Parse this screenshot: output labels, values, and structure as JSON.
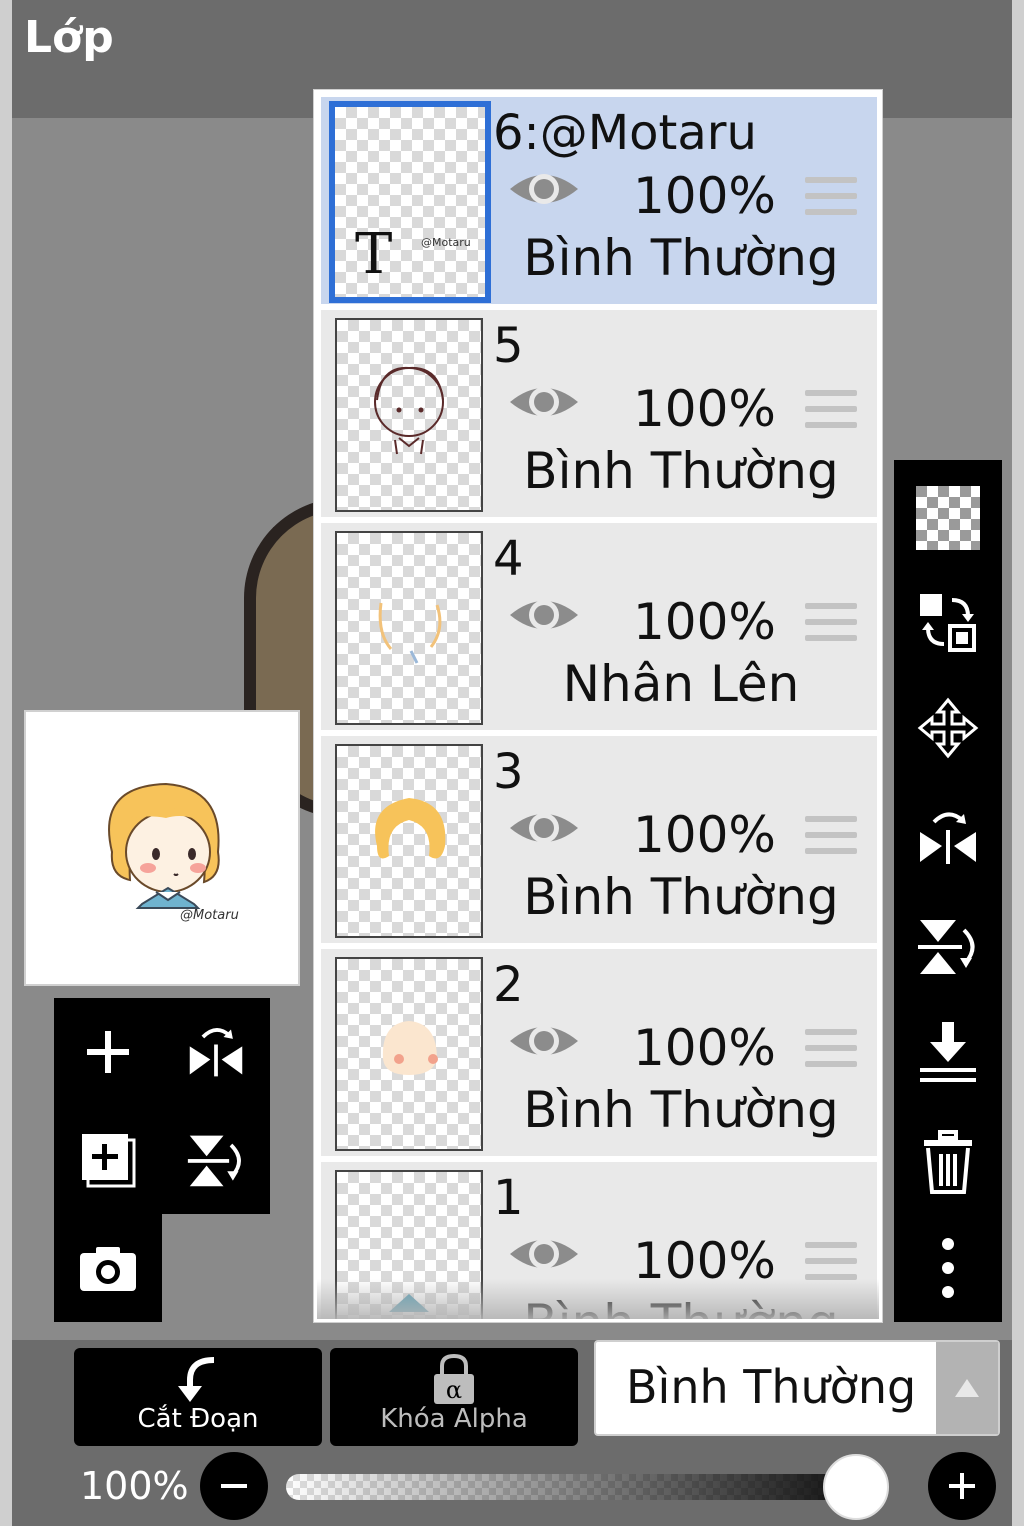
{
  "header": {
    "title": "Lớp"
  },
  "layers": [
    {
      "name": "6:@Motaru",
      "opacity": "100%",
      "blend": "Bình Thường",
      "visible": true,
      "selected": true,
      "thumb_sign": "@Motaru"
    },
    {
      "name": "5",
      "opacity": "100%",
      "blend": "Bình Thường",
      "visible": true,
      "selected": false
    },
    {
      "name": "4",
      "opacity": "100%",
      "blend": "Nhân Lên",
      "visible": true,
      "selected": false
    },
    {
      "name": "3",
      "opacity": "100%",
      "blend": "Bình Thường",
      "visible": true,
      "selected": false
    },
    {
      "name": "2",
      "opacity": "100%",
      "blend": "Bình Thường",
      "visible": true,
      "selected": false
    },
    {
      "name": "1",
      "opacity": "100%",
      "blend": "Bình Thường",
      "visible": true,
      "selected": false
    }
  ],
  "preview": {
    "signature": "@Motaru"
  },
  "bottom_bar": {
    "clip_label": "Cắt Đoạn",
    "alpha_lock_label": "Khóa Alpha",
    "blend_mode": "Bình Thường",
    "opacity_label": "100%",
    "opacity_value": 1.0
  },
  "colors": {
    "selected_row": "#c8d6ee",
    "selected_border": "#2e6fd6",
    "toolbar_bg": "#000000",
    "header_bg": "#6c6c6c",
    "canvas_bg": "#8a8a8a"
  },
  "icons": {
    "right_toolbar": [
      "transparent-fill-icon",
      "swap-layers-icon",
      "move-icon",
      "flip-horizontal-icon",
      "flip-vertical-icon",
      "merge-down-icon",
      "trash-icon",
      "more-vertical-icon"
    ],
    "left_toolbar": [
      "add-layer-icon",
      "flip-horizontal-icon",
      "add-copy-layer-icon",
      "flip-vertical-icon",
      "camera-icon"
    ]
  }
}
